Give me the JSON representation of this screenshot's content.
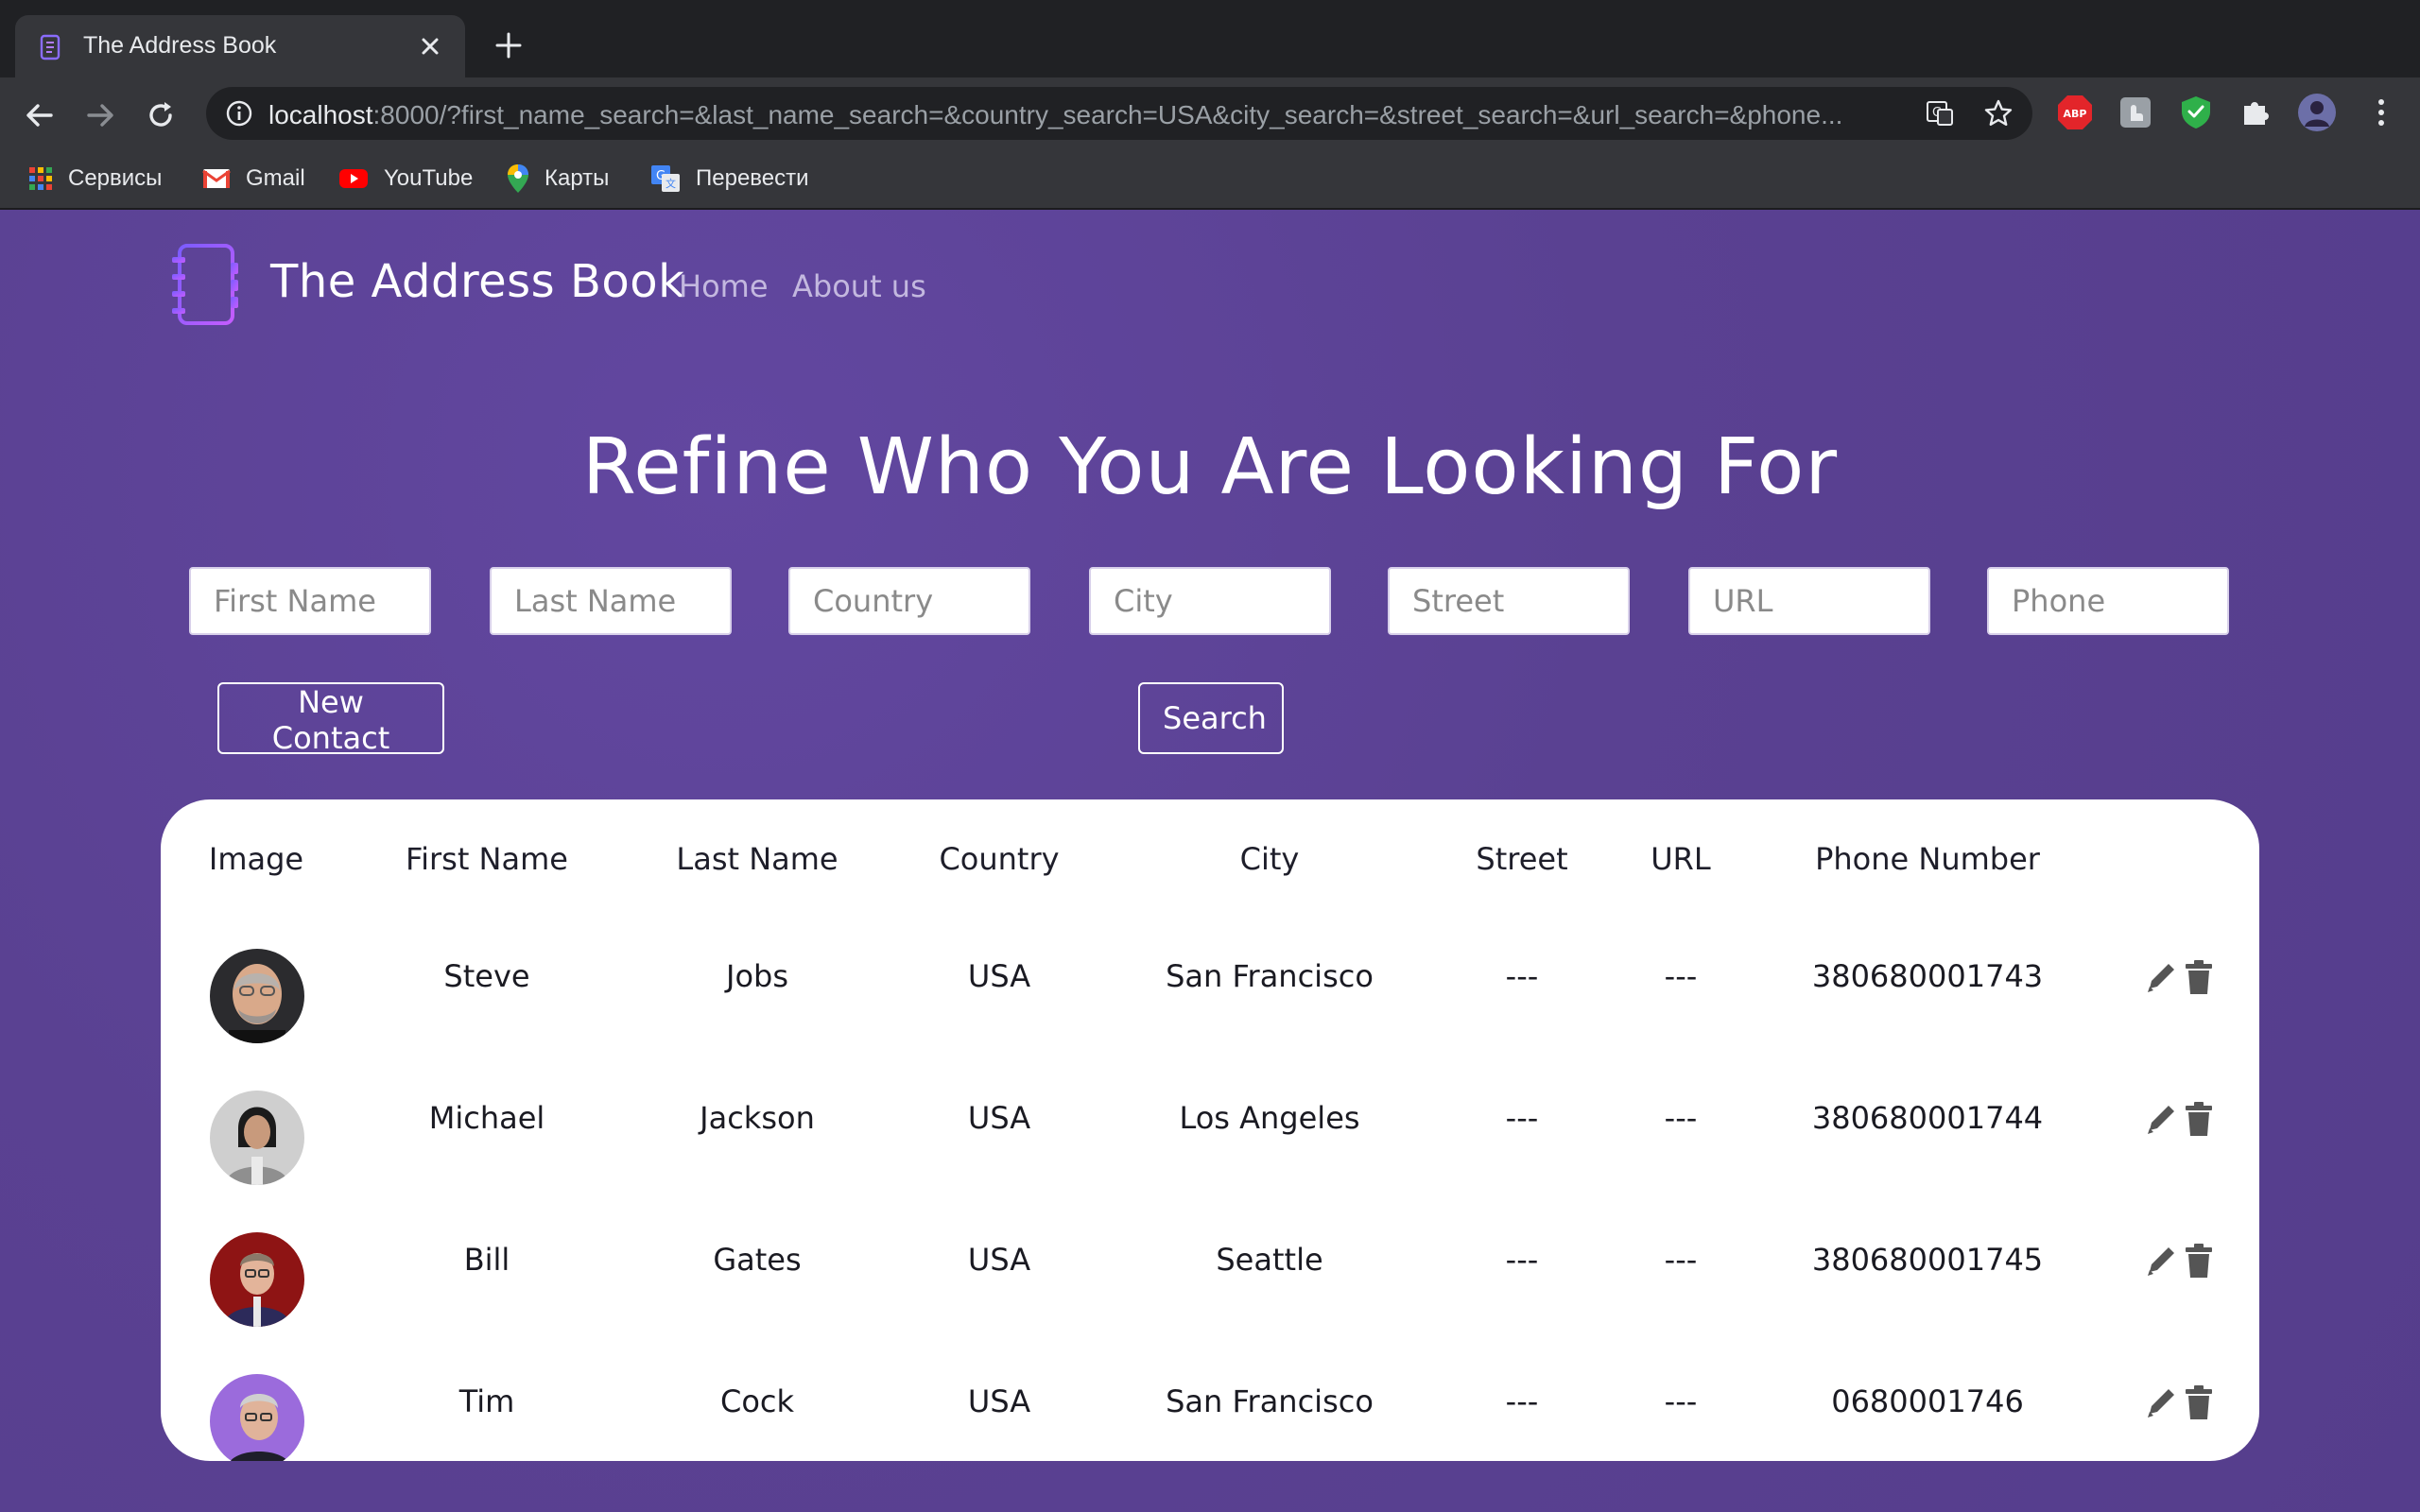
{
  "browser": {
    "tab_title": "The Address Book",
    "url_host": "localhost",
    "url_rest": ":8000/?first_name_search=&last_name_search=&country_search=USA&city_search=&street_search=&url_search=&phone...",
    "bookmarks": [
      {
        "label": "Сервисы",
        "icon": "apps-grid-icon"
      },
      {
        "label": "Gmail",
        "icon": "gmail-icon"
      },
      {
        "label": "YouTube",
        "icon": "youtube-icon"
      },
      {
        "label": "Карты",
        "icon": "maps-pin-icon"
      },
      {
        "label": "Перевести",
        "icon": "translate-icon"
      }
    ],
    "extensions": [
      "adblock-icon",
      "extension-icon",
      "shield-icon",
      "puzzle-icon",
      "profile-avatar",
      "kebab-menu-icon"
    ]
  },
  "header": {
    "brand": "The Address Book",
    "nav": {
      "home": "Home",
      "about": "About us"
    }
  },
  "search": {
    "headline": "Refine Who You Are Looking For",
    "placeholders": {
      "first_name": "First Name",
      "last_name": "Last Name",
      "country": "Country",
      "city": "City",
      "street": "Street",
      "url": "URL",
      "phone": "Phone"
    },
    "new_contact_label": "New Contact",
    "search_label": "Search"
  },
  "table": {
    "columns": {
      "image": "Image",
      "first_name": "First Name",
      "last_name": "Last Name",
      "country": "Country",
      "city": "City",
      "street": "Street",
      "url": "URL",
      "phone": "Phone Number"
    },
    "rows": [
      {
        "first_name": "Steve",
        "last_name": "Jobs",
        "country": "USA",
        "city": "San Francisco",
        "street": "---",
        "url": "---",
        "phone": "380680001743"
      },
      {
        "first_name": "Michael",
        "last_name": "Jackson",
        "country": "USA",
        "city": "Los Angeles",
        "street": "---",
        "url": "---",
        "phone": "380680001744"
      },
      {
        "first_name": "Bill",
        "last_name": "Gates",
        "country": "USA",
        "city": "Seattle",
        "street": "---",
        "url": "---",
        "phone": "380680001745"
      },
      {
        "first_name": "Tim",
        "last_name": "Cock",
        "country": "USA",
        "city": "San Francisco",
        "street": "---",
        "url": "---",
        "phone": "0680001746"
      }
    ]
  },
  "colors": {
    "page_background": "#5b4394",
    "brand_gradient_start": "#7b5cff",
    "brand_gradient_end": "#c45cff",
    "nav_link": "#c3b8df",
    "card_background": "#ffffff"
  }
}
